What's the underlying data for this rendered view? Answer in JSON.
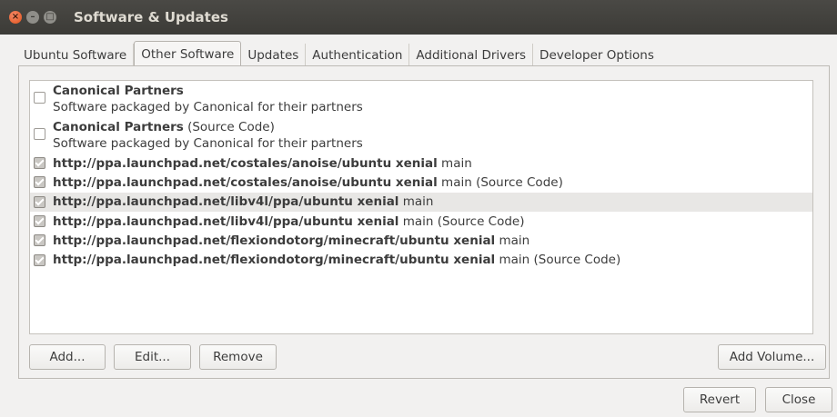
{
  "window": {
    "title": "Software & Updates",
    "controls": {
      "close": "×",
      "minimize": "–",
      "maximize": "□"
    }
  },
  "tabs": [
    {
      "label": "Ubuntu Software",
      "active": false
    },
    {
      "label": "Other Software",
      "active": true
    },
    {
      "label": "Updates",
      "active": false
    },
    {
      "label": "Authentication",
      "active": false
    },
    {
      "label": "Additional Drivers",
      "active": false
    },
    {
      "label": "Developer Options",
      "active": false
    }
  ],
  "sources": [
    {
      "checked": false,
      "title": "Canonical Partners",
      "title_suffix": "",
      "subtitle": "Software packaged by Canonical for their partners"
    },
    {
      "checked": false,
      "title": "Canonical Partners",
      "title_suffix": " (Source Code)",
      "subtitle": "Software packaged by Canonical for their partners"
    },
    {
      "checked": true,
      "url": "http://ppa.launchpad.net/costales/anoise/ubuntu xenial",
      "suffix": " main",
      "selected": false
    },
    {
      "checked": true,
      "url": "http://ppa.launchpad.net/costales/anoise/ubuntu xenial",
      "suffix": " main (Source Code)",
      "selected": false
    },
    {
      "checked": true,
      "url": "http://ppa.launchpad.net/libv4l/ppa/ubuntu xenial",
      "suffix": " main",
      "selected": true
    },
    {
      "checked": true,
      "url": "http://ppa.launchpad.net/libv4l/ppa/ubuntu xenial",
      "suffix": " main (Source Code)",
      "selected": false
    },
    {
      "checked": true,
      "url": "http://ppa.launchpad.net/flexiondotorg/minecraft/ubuntu xenial",
      "suffix": " main",
      "selected": false
    },
    {
      "checked": true,
      "url": "http://ppa.launchpad.net/flexiondotorg/minecraft/ubuntu xenial",
      "suffix": " main (Source Code)",
      "selected": false
    }
  ],
  "buttons": {
    "add": "Add...",
    "edit": "Edit...",
    "remove": "Remove",
    "add_volume": "Add Volume...",
    "revert": "Revert",
    "close": "Close"
  }
}
